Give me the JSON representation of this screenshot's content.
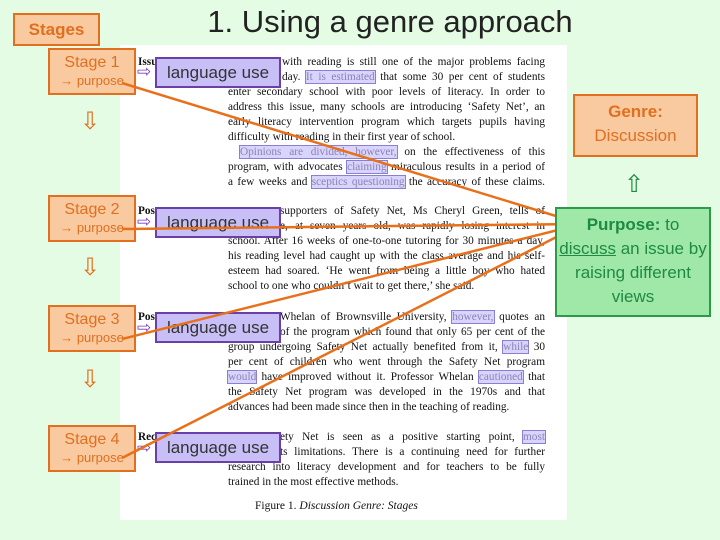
{
  "title": "1. Using a genre approach",
  "stages_label": "Stages",
  "stages": [
    {
      "label": "Stage 1",
      "purpose": "→ purpose"
    },
    {
      "label": "Stage 2",
      "purpose": "→ purpose"
    },
    {
      "label": "Stage 3",
      "purpose": "→ purpose"
    },
    {
      "label": "Stage 4",
      "purpose": "→ purpose"
    }
  ],
  "language_use_label": "language use",
  "genre": {
    "label": "Genre:",
    "value": "Discussion"
  },
  "purpose": {
    "label": "Purpose:",
    "pre": " to",
    "verb": "discuss",
    "rest": " an issue by raising different views"
  },
  "doc": {
    "stage_fragments": [
      "Issu",
      "Pos",
      "Pos",
      "Rec"
    ],
    "p1": [
      "with reading is still one of the major problems facing",
      "day.",
      "It is estimated",
      "that some 30 per cent of students",
      "enter secondary school with poor levels of literacy. In order to",
      "address this issue, many schools are introducing ‘Safety Net’, an",
      "early literacy intervention program which targets pupils having",
      "difficulty with reading in their first year of school."
    ],
    "p2": [
      "Opinions are divided, however,",
      "on the effectiveness of this",
      "program, with advocates",
      "claiming",
      "miraculous results in a period of",
      "a few weeks and",
      "sceptics questioning",
      "the accuracy of these claims."
    ],
    "p3": [
      "supporters of Safety Net, Ms Cheryl Green, tells of",
      "e, at seven years old, was rapidly losing interest in",
      "school. After 16 weeks of one-to-one tutoring for 30 minutes a day,",
      "his reading level had caught up with the class average and his self-",
      "esteem had soared. ‘He went from being a little boy who hated",
      "school to one who couldn’t wait to get there,’ she said."
    ],
    "p4": [
      "Whelan of Brownsville University,",
      "however,",
      "quotes an",
      "of the program which found that only 65 per cent of the",
      "group undergoing Safety Net actually benefited from it,",
      "while",
      "30",
      "per cent of children who went through the Safety Net program",
      "would",
      "have improved without it. Professor Whelan",
      "cautioned",
      "that",
      "the Safety Net program was developed in the 1970s and that",
      "advances had been made since then in the teaching of reading."
    ],
    "p5": [
      "ety Net is seen as a positive starting point,",
      "most",
      "ts limitations. There is a continuing need for further",
      "research into literacy development and for teachers to be fully",
      "trained in the most effective methods."
    ],
    "caption_prefix": "Figure 1.",
    "caption": " Discussion Genre: Stages"
  },
  "colors": {
    "background": "#e4fbe4",
    "stage": "#e0701f",
    "language_use": "#6a3fa8",
    "purpose": "#2b9a4b"
  }
}
